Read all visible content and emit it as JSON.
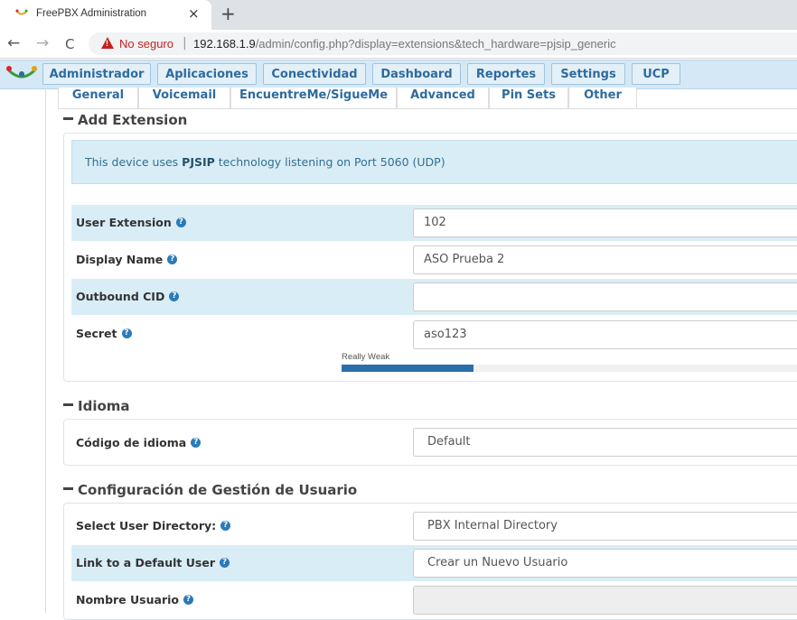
{
  "browser": {
    "tab_title": "FreePBX Administration",
    "tab_close": "×",
    "new_tab": "+",
    "back": "←",
    "forward": "→",
    "reload": "C",
    "security_label": "No seguro",
    "separator": "|",
    "url_host": "192.168.1.9",
    "url_path": "/admin/config.php?display=extensions&tech_hardware=pjsip_generic"
  },
  "menu": {
    "items": [
      "Administrador",
      "Aplicaciones",
      "Conectividad",
      "Dashboard",
      "Reportes",
      "Settings",
      "UCP"
    ]
  },
  "tabs": {
    "items": [
      "General",
      "Voicemail",
      "EncuentreMe/SigueMe",
      "Advanced",
      "Pin Sets",
      "Other"
    ],
    "active": "General"
  },
  "add_extension": {
    "title": "Add Extension",
    "info_prefix": "This device uses ",
    "info_tech": "PJSIP",
    "info_suffix": " technology listening on Port 5060 (UDP)",
    "fields": {
      "user_extension": {
        "label": "User Extension",
        "value": "102"
      },
      "display_name": {
        "label": "Display Name",
        "value": "ASO Prueba 2"
      },
      "outbound_cid": {
        "label": "Outbound CID",
        "value": ""
      },
      "secret": {
        "label": "Secret",
        "value": "aso123",
        "strength_label": "Really Weak",
        "strength_fraction": 0.29
      }
    }
  },
  "idioma": {
    "title": "Idioma",
    "language_code": {
      "label": "Código de idioma",
      "value": "Default"
    }
  },
  "user_management": {
    "title": "Configuración de Gestión de Usuario",
    "select_directory": {
      "label": "Select User Directory:",
      "value": "PBX Internal Directory"
    },
    "link_default_user": {
      "label": "Link to a Default User",
      "value": "Crear un Nuevo Usuario"
    },
    "username": {
      "label": "Nombre Usuario",
      "value": ""
    }
  },
  "help_glyph": "?",
  "colors": {
    "accent": "#2e6b9e",
    "info_bg": "#d9edf7",
    "warning": "#c5221f",
    "meter": "#2a6fac"
  }
}
